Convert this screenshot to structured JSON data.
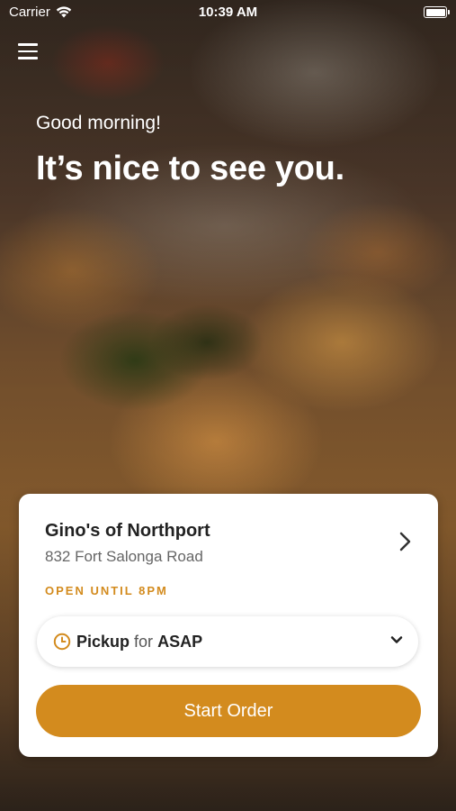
{
  "status_bar": {
    "carrier": "Carrier",
    "time": "10:39 AM"
  },
  "hero": {
    "greeting": "Good morning!",
    "headline": "It’s nice to see you."
  },
  "store": {
    "name": "Gino's of Northport",
    "address": "832 Fort Salonga Road",
    "hours_status": "OPEN UNTIL 8PM"
  },
  "order": {
    "mode": "Pickup",
    "connector": "for",
    "time": "ASAP",
    "start_label": "Start Order"
  },
  "colors": {
    "accent": "#d38b1e"
  },
  "icons": [
    "wifi-icon",
    "battery-icon",
    "hamburger-menu-icon",
    "chevron-right-icon",
    "clock-icon",
    "chevron-down-icon"
  ]
}
